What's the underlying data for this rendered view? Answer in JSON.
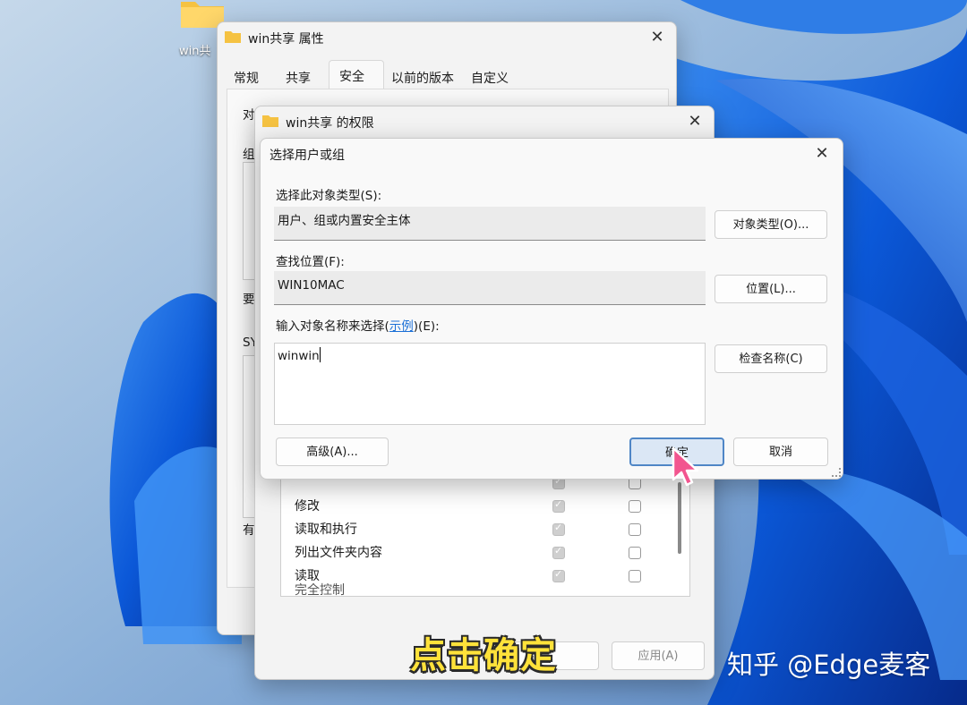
{
  "desktop": {
    "folder_label": "win共"
  },
  "properties_window": {
    "title": "win共享 属性",
    "tabs": [
      "常规",
      "共享",
      "安全",
      "以前的版本",
      "自定义"
    ],
    "fragments": [
      "对",
      "组",
      "要",
      "SY",
      "有"
    ]
  },
  "permissions_window": {
    "title": "win共享 的权限",
    "permissions": [
      {
        "label": "完全控制",
        "allow": true,
        "deny": false
      },
      {
        "label": "修改",
        "allow": true,
        "deny": false
      },
      {
        "label": "读取和执行",
        "allow": true,
        "deny": false
      },
      {
        "label": "列出文件夹内容",
        "allow": true,
        "deny": false
      },
      {
        "label": "读取",
        "allow": true,
        "deny": false
      }
    ],
    "apply_label": "应用(A)"
  },
  "select_dialog": {
    "title": "选择用户或组",
    "object_type_label": "选择此对象类型(S):",
    "object_type_value": "用户、组或内置安全主体",
    "object_type_button": "对象类型(O)...",
    "location_label": "查找位置(F):",
    "location_value": "WIN10MAC",
    "location_button": "位置(L)...",
    "enter_names_label_pre": "输入对象名称来选择(",
    "enter_names_link": "示例",
    "enter_names_label_post": ")(E):",
    "names_value": "winwin",
    "check_names_button": "检查名称(C)",
    "advanced_button": "高级(A)...",
    "ok_button": "确定",
    "cancel_button": "取消"
  },
  "overlay": {
    "caption": "点击确定",
    "watermark": "知乎 @Edge麦客"
  },
  "colors": {
    "accent": "#4f86c6",
    "caption_yellow": "#ffe23a",
    "link_blue": "#1a6fd6",
    "folder_yellow": "#f5c242"
  }
}
